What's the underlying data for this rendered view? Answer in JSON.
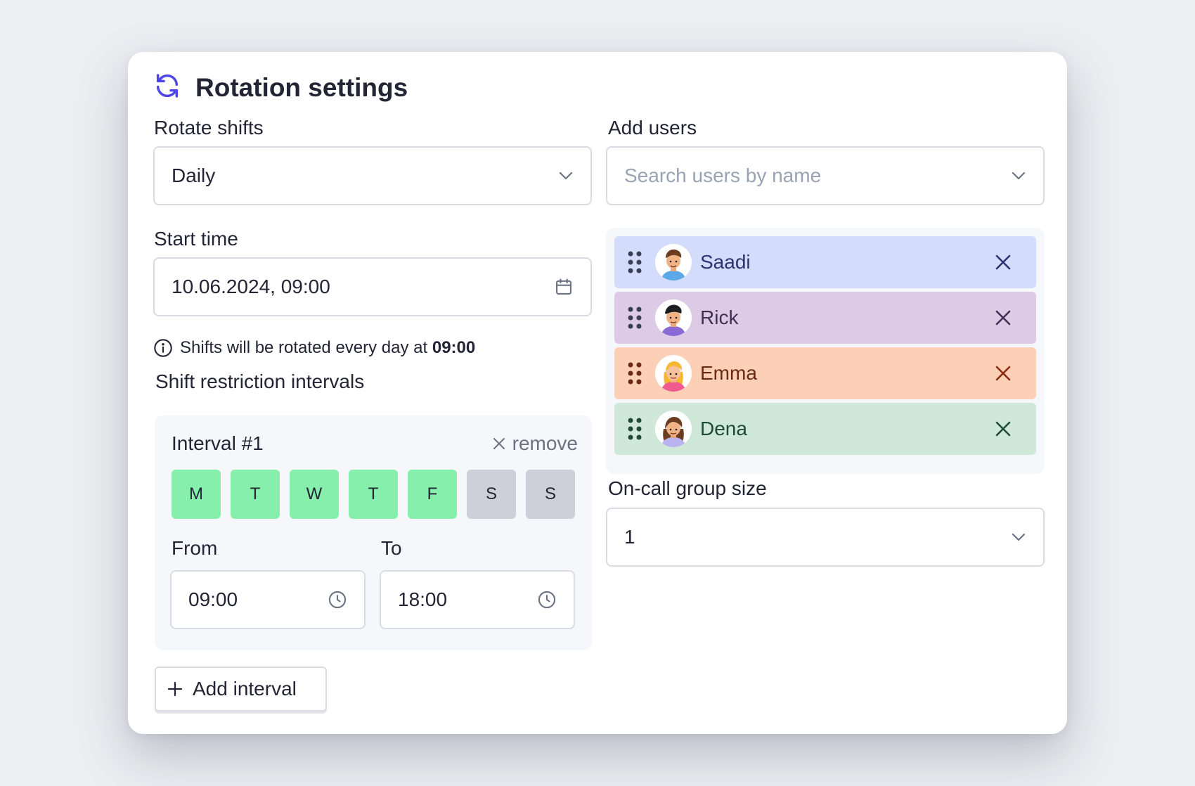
{
  "title": "Rotation settings",
  "rotate": {
    "label": "Rotate shifts",
    "value": "Daily"
  },
  "start": {
    "label": "Start time",
    "value": "10.06.2024, 09:00"
  },
  "hint": {
    "prefix": "Shifts will be rotated every day at",
    "time": "09:00"
  },
  "restrictions": {
    "label": "Shift restriction intervals",
    "interval_title": "Interval #1",
    "remove_label": "remove",
    "days": [
      {
        "label": "M",
        "active": true
      },
      {
        "label": "T",
        "active": true
      },
      {
        "label": "W",
        "active": true
      },
      {
        "label": "T",
        "active": true
      },
      {
        "label": "F",
        "active": true
      },
      {
        "label": "S",
        "active": false
      },
      {
        "label": "S",
        "active": false
      }
    ],
    "from_label": "From",
    "from_value": "09:00",
    "to_label": "To",
    "to_value": "18:00"
  },
  "add_interval_label": "Add interval",
  "users": {
    "label": "Add users",
    "search_placeholder": "Search users by name",
    "list": [
      {
        "name": "Saadi",
        "bg": "#d3dcfb",
        "fg": "#2f3470"
      },
      {
        "name": "Rick",
        "bg": "#ddcbe6",
        "fg": "#3f2f52"
      },
      {
        "name": "Emma",
        "bg": "#fbd0b6",
        "fg": "#6b2a12"
      },
      {
        "name": "Dena",
        "bg": "#cfe8d8",
        "fg": "#1f4a33"
      }
    ]
  },
  "group_size": {
    "label": "On-call group size",
    "value": "1"
  },
  "colors": {
    "accent": "#4f46e5",
    "day_on": "#86efac",
    "day_off": "#cdd0d9"
  }
}
